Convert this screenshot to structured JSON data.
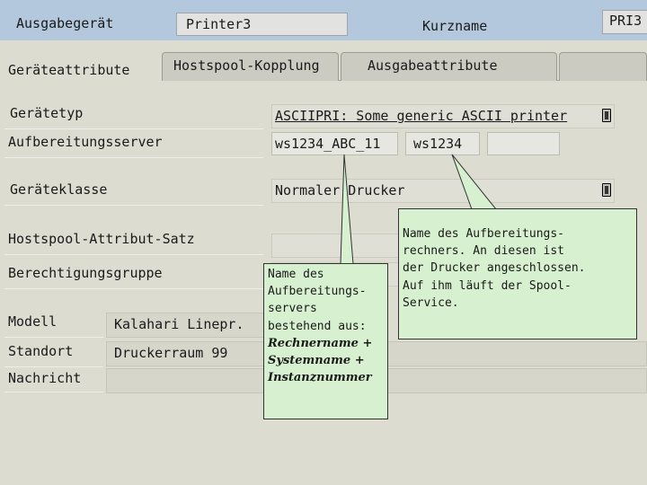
{
  "header": {
    "output_device_label": "Ausgabegerät",
    "output_device_value": "Printer3",
    "short_name_label": "Kurzname",
    "short_name_value": "PRI3"
  },
  "tabs": [
    {
      "label": "Geräteattribute",
      "active": true
    },
    {
      "label": "Hostspool-Kopplung",
      "active": false
    },
    {
      "label": "Ausgabeattribute",
      "active": false
    }
  ],
  "form": {
    "device_type": {
      "label": "Gerätetyp",
      "value": "ASCIIPRI: Some generic ASCII printer"
    },
    "spool_server": {
      "label": "Aufbereitungsserver",
      "value1": "ws1234_ABC_11",
      "value2": "ws1234",
      "value3": ""
    },
    "device_class": {
      "label": "Geräteklasse",
      "value": "Normaler Drucker"
    },
    "hostspool_attr": {
      "label": "Hostspool-Attribut-Satz",
      "value": ""
    },
    "auth_group": {
      "label": "Berechtigungsgruppe",
      "value": ""
    },
    "model": {
      "label": "Modell",
      "value": "Kalahari Linepr."
    },
    "location": {
      "label": "Standort",
      "value": "Druckerraum 99"
    },
    "message": {
      "label": "Nachricht",
      "value": ""
    }
  },
  "callouts": {
    "server_note": {
      "intro": "Name des\nAufbereitungs-\nservers\nbestehend aus:",
      "part1": "Rechnername +",
      "part2": "Systemname +",
      "part3": "Instanznummer"
    },
    "host_note": "Name des Aufbereitungs-\nrechners. An diesen ist\nder Drucker angeschlossen.\nAuf ihm läuft der Spool-\nService."
  },
  "colors": {
    "header_bg": "#b3c8dc",
    "window_bg": "#dcdcd0",
    "callout_bg": "#d7f0cf"
  }
}
